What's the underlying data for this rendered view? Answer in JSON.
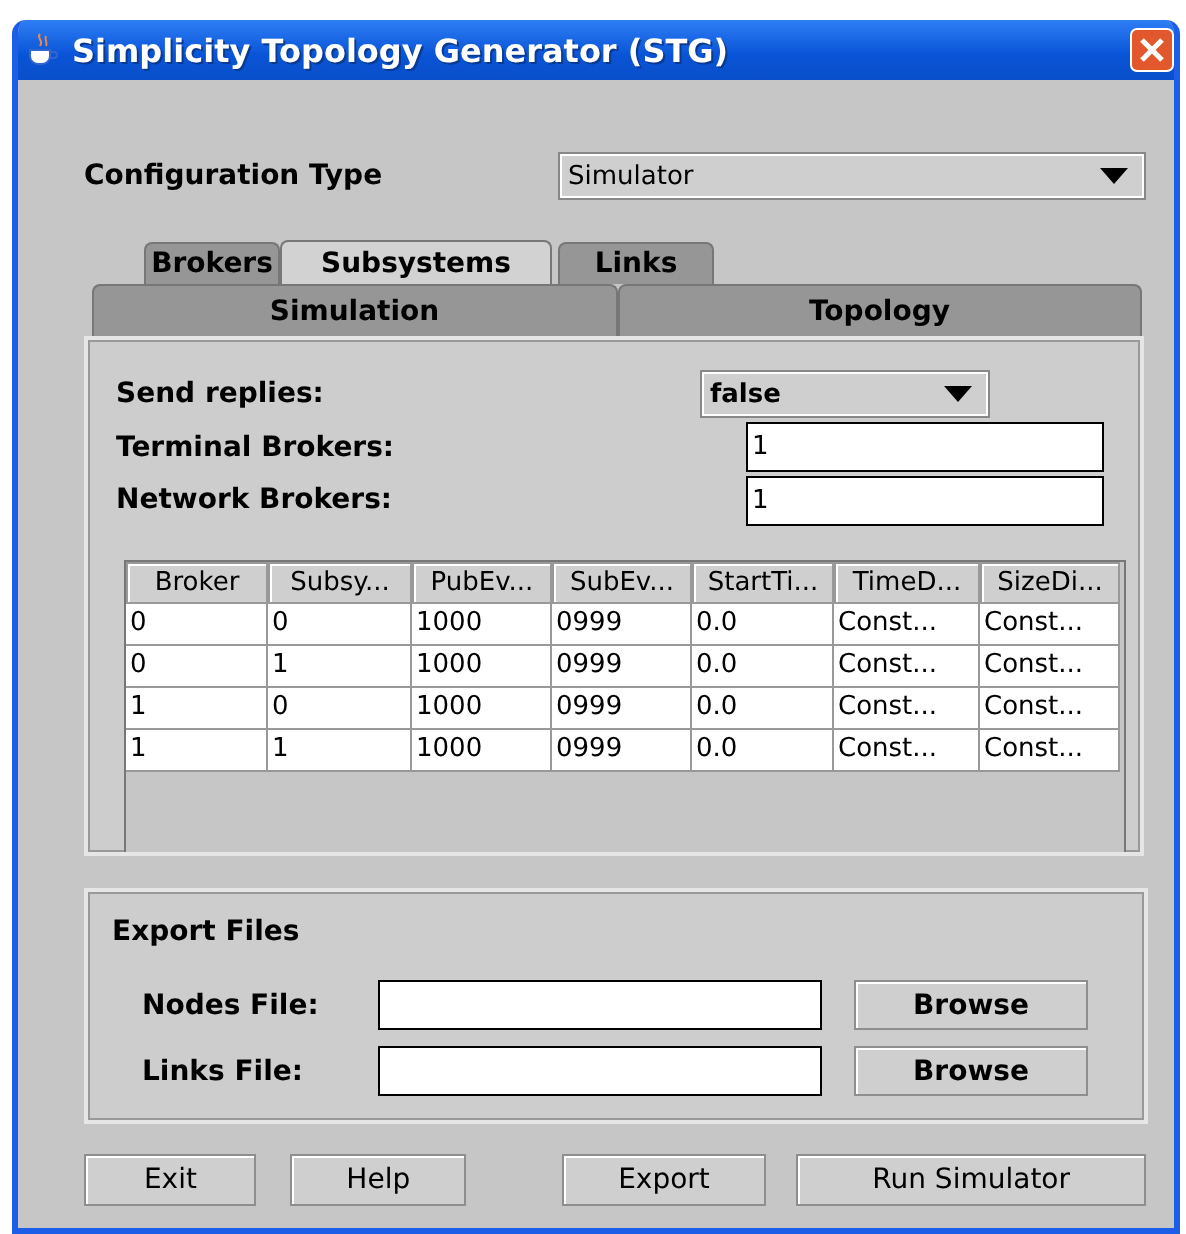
{
  "window": {
    "title": "Simplicity Topology Generator (STG)"
  },
  "configuration_type": {
    "label": "Configuration Type",
    "value": "Simulator"
  },
  "tab_rows": [
    {
      "tabs": [
        {
          "label": "Brokers",
          "selected": false
        },
        {
          "label": "Subsystems",
          "selected": true
        },
        {
          "label": "Links",
          "selected": false
        }
      ]
    },
    {
      "tabs": [
        {
          "label": "Simulation",
          "selected": false
        },
        {
          "label": "Topology",
          "selected": false
        }
      ]
    }
  ],
  "settings": [
    {
      "kind": "combo",
      "label": "Send replies:",
      "value": "false"
    },
    {
      "kind": "text",
      "label": "Terminal Brokers:",
      "value": "1"
    },
    {
      "kind": "text",
      "label": "Network Brokers:",
      "value": "1"
    }
  ],
  "table": {
    "columns": [
      "Broker",
      "Subsy...",
      "PubEv...",
      "SubEv...",
      "StartTi...",
      "TimeD...",
      "SizeDi..."
    ],
    "rows": [
      [
        "0",
        "0",
        "1000",
        "0999",
        "0.0",
        "Const...",
        "Const..."
      ],
      [
        "0",
        "1",
        "1000",
        "0999",
        "0.0",
        "Const...",
        "Const..."
      ],
      [
        "1",
        "0",
        "1000",
        "0999",
        "0.0",
        "Const...",
        "Const..."
      ],
      [
        "1",
        "1",
        "1000",
        "0999",
        "0.0",
        "Const...",
        "Const..."
      ]
    ]
  },
  "export_files": {
    "title": "Export Files",
    "files": [
      {
        "label": "Nodes File:",
        "button": "Browse"
      },
      {
        "label": "Links File:",
        "button": "Browse"
      }
    ]
  },
  "buttons": [
    "Exit",
    "Help",
    "Export",
    "Run Simulator"
  ]
}
